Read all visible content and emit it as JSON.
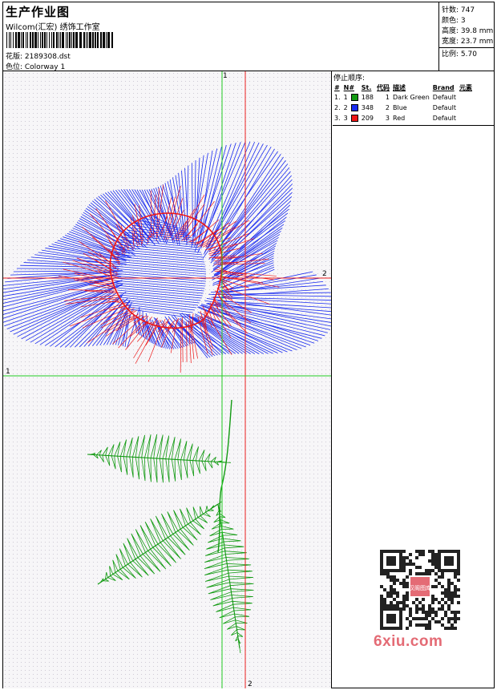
{
  "header": {
    "title": "生产作业图",
    "company": "Wilcom(汇宏) 绣饰工作室",
    "design_label": "花版: 2189308.dst",
    "colorway_label": "色位: Colorway 1"
  },
  "stats": {
    "stitches": "针数: 747",
    "colors": "颜色: 3",
    "height": "高度: 39.8 mm",
    "width": "宽度: 23.7 mm",
    "scale": "比例: 5.70"
  },
  "legend": {
    "title": "停止顺序:",
    "columns": [
      "#",
      "N#",
      "St.",
      "代码",
      "描述",
      "Brand",
      "元素"
    ],
    "rows": [
      {
        "idx": "1.",
        "n": "1",
        "color": "#129a12",
        "st": "188",
        "code": "1",
        "desc": "Dark Green",
        "brand": "Default"
      },
      {
        "idx": "2.",
        "n": "2",
        "color": "#1a2cf0",
        "st": "348",
        "code": "2",
        "desc": "Blue",
        "brand": "Default"
      },
      {
        "idx": "3.",
        "n": "3",
        "color": "#ee1616",
        "st": "209",
        "code": "3",
        "desc": "Red",
        "brand": "Default"
      }
    ]
  },
  "canvas": {
    "axis_labels": {
      "v_green": "1",
      "h_red": "2",
      "h_green": "1",
      "v_red": "2"
    },
    "colors": {
      "green": "#129a12",
      "blue": "#1a2cf0",
      "red": "#ee1616",
      "guide_green": "#22cc22",
      "guide_red": "#ee2222"
    }
  },
  "watermark": "6xiu.com",
  "qr_badge": "汉阁图库"
}
